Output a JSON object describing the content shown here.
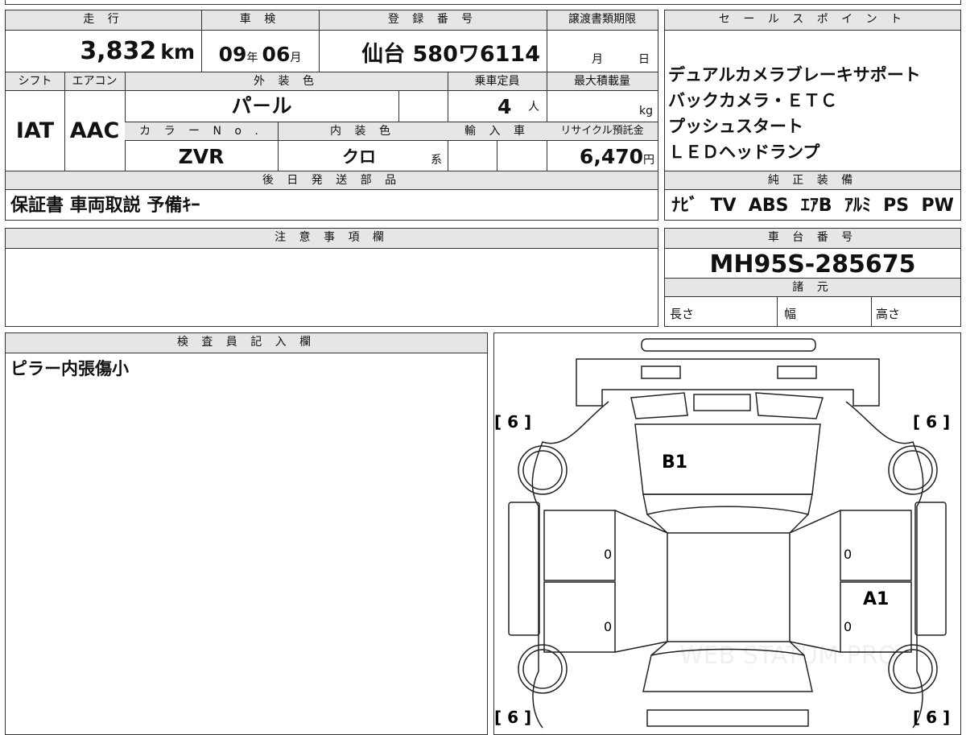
{
  "main_table": {
    "mileage_header": "走 行",
    "mileage_value": "3,832",
    "mileage_unit": "km",
    "inspection_header": "車 検",
    "inspection_year": "09",
    "inspection_year_unit": "年",
    "inspection_month": "06",
    "inspection_month_unit": "月",
    "registration_header": "登 録 番 号",
    "registration_value": "仙台 580ワ6114",
    "transfer_deadline_header": "譲渡書類期限",
    "transfer_month_unit": "月",
    "transfer_day_unit": "日",
    "shift_header": "シフト",
    "shift_value": "IAT",
    "aircon_header": "エアコン",
    "aircon_value": "AAC",
    "exterior_color_header": "外 装 色",
    "exterior_color_value": "パ－ル",
    "capacity_header": "乗車定員",
    "capacity_value": "4",
    "capacity_unit": "人",
    "max_load_header": "最大積載量",
    "max_load_unit": "kg",
    "color_no_header": "カ ラ ー N o .",
    "color_no_value": "ZVR",
    "interior_color_header": "内 装 色",
    "interior_color_value": "クロ",
    "interior_color_unit": "系",
    "import_header": "輸 入 車",
    "recycle_header": "リサイクル預託金",
    "recycle_value": "6,470",
    "recycle_unit": "円",
    "later_parts_header": "後 日 発 送 部 品",
    "later_parts_value": "保証書 車両取説 予備ｷｰ"
  },
  "sales_points": {
    "header": "セ ー ル ス ポ イ ン ト",
    "items": [
      "デュアルカメラブレーキサポート",
      "バックカメラ・ＥＴＣ",
      "プッシュスタート",
      "ＬＥＤヘッドランプ"
    ]
  },
  "genuine_equipment": {
    "header": "純 正 装 備",
    "value": "ﾅﾋﾞ  TV  ABS  ｴｱB  ｱﾙﾐ  PS  PW"
  },
  "notes": {
    "header": "注 意 事 項 欄",
    "value": ""
  },
  "chassis": {
    "header": "車 台 番 号",
    "value": "MH95S-285675"
  },
  "specs": {
    "header": "諸 元",
    "length_label": "長さ",
    "width_label": "幅",
    "height_label": "高さ"
  },
  "inspector": {
    "header": "検 査 員 記 入 欄",
    "comment": "ピラー内張傷小"
  },
  "diagram": {
    "tire_front_left": "[ 6 ]",
    "tire_front_right": "[ 6 ]",
    "tire_rear_left": "[ 6 ]",
    "tire_rear_right": "[ 6 ]",
    "mark_hood": "B1",
    "mark_rear_right_door": "A1",
    "door_fl": "0",
    "door_rl": "0",
    "door_fr": "0",
    "door_rr": "0",
    "watermark": "WEB STATUM PRO"
  }
}
